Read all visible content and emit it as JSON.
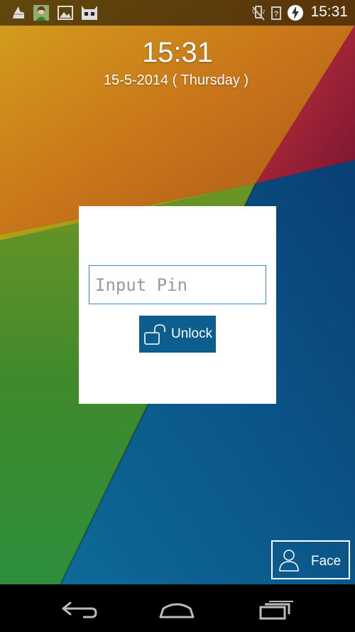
{
  "status_bar": {
    "time": "15:31",
    "left_icons": [
      "cleaner-icon",
      "contact-photo-icon",
      "image-icon",
      "cyanogen-mascot-icon"
    ],
    "right_icons": [
      "muted-icon",
      "no-signal-icon",
      "charging-icon"
    ]
  },
  "lockscreen": {
    "clock": "15:31",
    "date": "15-5-2014 ( Thursday )"
  },
  "pin_panel": {
    "input_placeholder": "Input Pin",
    "input_value": "",
    "unlock_label": "Unlock"
  },
  "face_button": {
    "label": "Face"
  },
  "nav_bar": {
    "buttons": [
      "back-icon",
      "home-icon",
      "recents-icon"
    ]
  },
  "colors": {
    "accent_blue": "#0b5e8e",
    "input_border": "#3a8ad0",
    "wallpaper_orange": "#d07a16",
    "wallpaper_green": "#4b8d27",
    "wallpaper_blue": "#0b5d8a",
    "wallpaper_red": "#b8233a"
  }
}
